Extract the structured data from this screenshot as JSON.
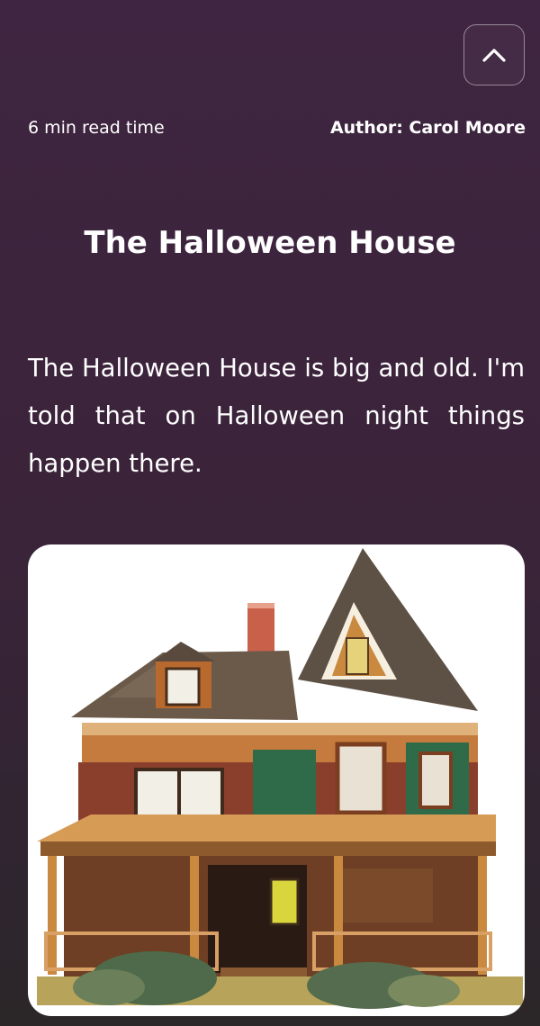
{
  "navigation": {
    "scroll_top_icon": "chevron-up-icon"
  },
  "article": {
    "read_time": "6 min read time",
    "author": "Author: Carol Moore",
    "title": "The Halloween House",
    "intro": "The Halloween House is big and old. I'm told that on Halloween night things happen there.",
    "image_subject": "victorian-house-icon"
  },
  "colors": {
    "background": "#3f2541",
    "text": "#ffffff",
    "card": "#ffffff"
  }
}
